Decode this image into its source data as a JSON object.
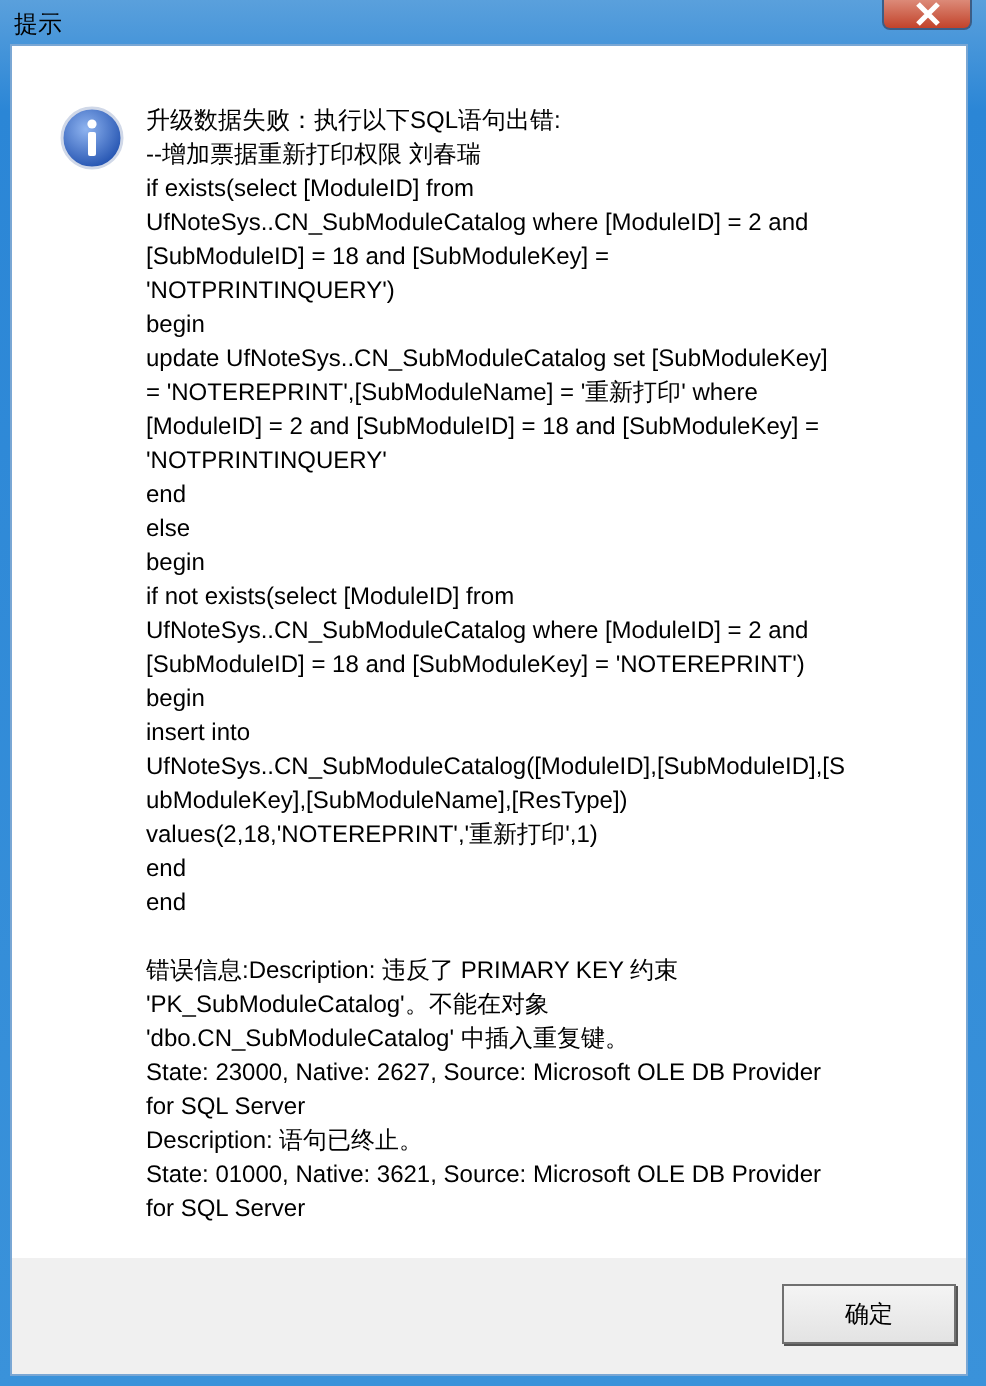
{
  "window": {
    "title": "提示"
  },
  "message_sections": [
    {
      "lines": [
        "升级数据失败：执行以下SQL语句出错:",
        "--增加票据重新打印权限 刘春瑞",
        "if exists(select [ModuleID] from",
        "UfNoteSys..CN_SubModuleCatalog where [ModuleID] = 2 and",
        "[SubModuleID] = 18 and [SubModuleKey] =",
        "'NOTPRINTINQUERY')",
        "begin",
        "update UfNoteSys..CN_SubModuleCatalog set [SubModuleKey]",
        "= 'NOTEREPRINT',[SubModuleName] = '重新打印' where",
        "[ModuleID] = 2 and [SubModuleID] = 18 and [SubModuleKey] =",
        "'NOTPRINTINQUERY'",
        "end",
        "else",
        "begin",
        "if not exists(select [ModuleID] from",
        "UfNoteSys..CN_SubModuleCatalog where [ModuleID] = 2 and",
        "[SubModuleID] = 18 and [SubModuleKey] = 'NOTEREPRINT')",
        "begin",
        "insert into",
        "UfNoteSys..CN_SubModuleCatalog([ModuleID],[SubModuleID],[S",
        "ubModuleKey],[SubModuleName],[ResType])",
        "values(2,18,'NOTEREPRINT','重新打印',1)",
        "end",
        "end"
      ]
    },
    {
      "lines": [
        "错误信息:Description: 违反了 PRIMARY KEY 约束",
        "'PK_SubModuleCatalog'。不能在对象",
        "'dbo.CN_SubModuleCatalog' 中插入重复键。",
        "State: 23000, Native: 2627, Source: Microsoft OLE DB Provider",
        "for SQL Server",
        "Description: 语句已终止。",
        "State: 01000, Native: 3621, Source: Microsoft OLE DB Provider",
        "for SQL Server"
      ]
    }
  ],
  "buttons": [
    {
      "label": "确定"
    }
  ]
}
